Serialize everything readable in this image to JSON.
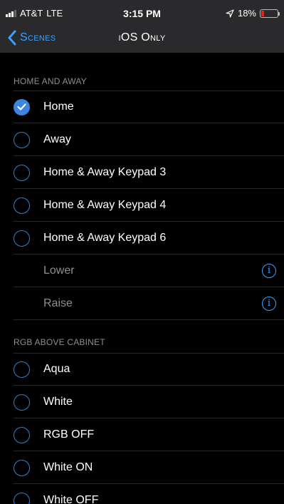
{
  "status_bar": {
    "carrier": "AT&T",
    "network": "LTE",
    "time": "3:15 PM",
    "battery_text": "18%",
    "battery_level": 0.18,
    "battery_color": "#e0241b"
  },
  "nav": {
    "back_label": "Scenes",
    "title": "iOS Only"
  },
  "sections": [
    {
      "header": "HOME AND AWAY",
      "rows": [
        {
          "label": "Home",
          "type": "radio",
          "checked": true
        },
        {
          "label": "Away",
          "type": "radio",
          "checked": false
        },
        {
          "label": "Home & Away Keypad 3",
          "type": "radio",
          "checked": false
        },
        {
          "label": "Home & Away Keypad 4",
          "type": "radio",
          "checked": false
        },
        {
          "label": "Home & Away Keypad 6",
          "type": "radio",
          "checked": false
        },
        {
          "label": "Lower",
          "type": "info",
          "info_glyph": "i"
        },
        {
          "label": "Raise",
          "type": "info",
          "info_glyph": "i"
        }
      ]
    },
    {
      "header": "RGB ABOVE CABINET",
      "rows": [
        {
          "label": "Aqua",
          "type": "radio",
          "checked": false
        },
        {
          "label": "White",
          "type": "radio",
          "checked": false
        },
        {
          "label": "RGB OFF",
          "type": "radio",
          "checked": false
        },
        {
          "label": "White ON",
          "type": "radio",
          "checked": false
        },
        {
          "label": "White OFF",
          "type": "radio",
          "checked": false
        }
      ]
    }
  ],
  "colors": {
    "accent": "#3aa0ff",
    "background": "#000000",
    "bar_background": "#2a2a2c",
    "secondary_text": "#8e8e93"
  }
}
